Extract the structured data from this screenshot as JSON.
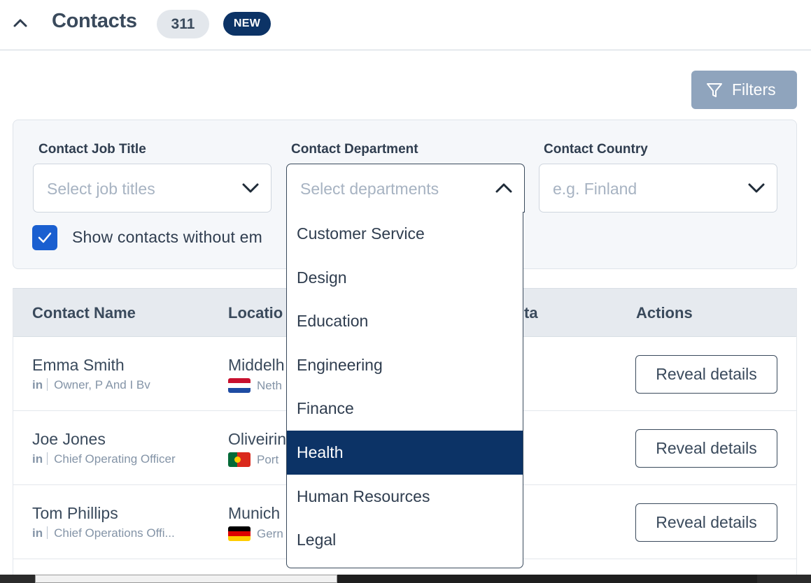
{
  "header": {
    "title": "Contacts",
    "count": "311",
    "badge": "NEW"
  },
  "toolbar": {
    "filters_label": "Filters"
  },
  "filters": {
    "job_title": {
      "label": "Contact Job Title",
      "placeholder": "Select job titles"
    },
    "department": {
      "label": "Contact Department",
      "placeholder": "Select departments"
    },
    "country": {
      "label": "Contact Country",
      "placeholder": "e.g. Finland"
    },
    "show_without_email": {
      "label": "Show contacts without em",
      "checked": true
    }
  },
  "department_options": [
    {
      "label": "Customer Service"
    },
    {
      "label": "Design"
    },
    {
      "label": "Education"
    },
    {
      "label": "Engineering"
    },
    {
      "label": "Finance"
    },
    {
      "label": "Health",
      "highlighted": true
    },
    {
      "label": "Human Resources"
    },
    {
      "label": "Legal"
    }
  ],
  "table": {
    "headers": [
      "Contact Name",
      "Locatio",
      "ta",
      "Actions"
    ],
    "rows": [
      {
        "name": "Emma Smith",
        "linkedin": "in",
        "title": "Owner, P And I Bv",
        "location": "Middelh",
        "country": "Neth",
        "flag": "netherlands-flag-icon",
        "action": "Reveal details"
      },
      {
        "name": "Joe Jones",
        "linkedin": "in",
        "title": "Chief Operating Officer",
        "location": "Oliveirin",
        "country": "Port",
        "flag": "portugal-flag-icon",
        "action": "Reveal details"
      },
      {
        "name": "Tom Phillips",
        "linkedin": "in",
        "title": "Chief Operations Offi...",
        "location": "Munich",
        "country": "Gern",
        "flag": "germany-flag-icon",
        "action": "Reveal details"
      }
    ]
  },
  "colors": {
    "navy": "#0c3366",
    "checkbox_blue": "#1a5fd0",
    "filters_button": "#8fa4bd"
  }
}
